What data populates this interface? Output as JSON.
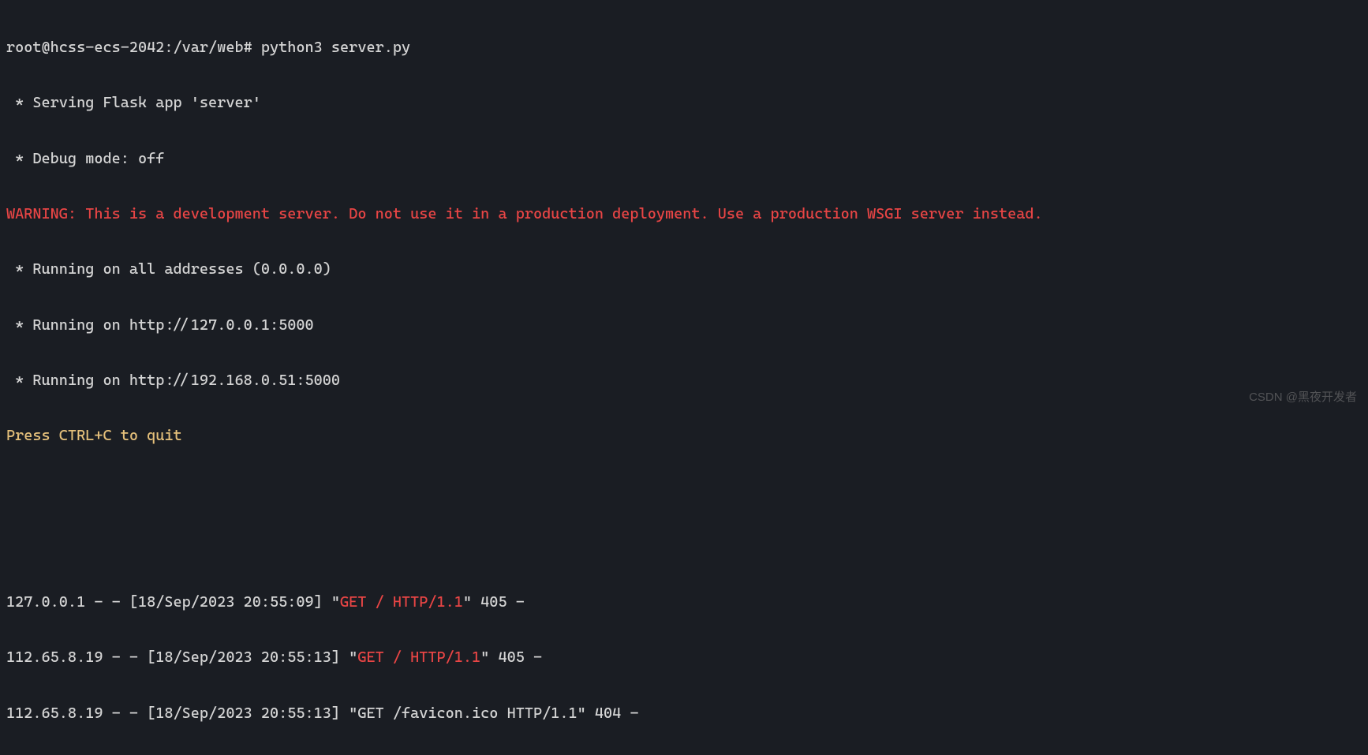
{
  "terminal": {
    "prompt_line": "root@hcss-ecs-2042:/var/web# python3 server.py",
    "serving_line": " * Serving Flask app 'server'",
    "debug_line": " * Debug mode: off",
    "warning_line": "WARNING: This is a development server. Do not use it in a production deployment. Use a production WSGI server instead.",
    "running_all": " * Running on all addresses (0.0.0.0)",
    "running_local": " * Running on http://127.0.0.1:5000",
    "running_ip": " * Running on http://192.168.0.51:5000",
    "press_quit": "Press CTRL+C to quit",
    "log1": {
      "prefix": "127.0.0.1 - - [18/Sep/2023 20:55:09] \"",
      "method": "GET / HTTP/1.1",
      "suffix": "\" 405 -"
    },
    "log2": {
      "prefix": "112.65.8.19 - - [18/Sep/2023 20:55:13] \"",
      "method": "GET / HTTP/1.1",
      "suffix": "\" 405 -"
    },
    "log3": {
      "prefix": "112.65.8.19 - - [18/Sep/2023 20:55:13] \"",
      "method": "GET /favicon.ico HTTP/1.1",
      "suffix": "\" 404 -"
    }
  },
  "watermark": "CSDN @黑夜开发者"
}
